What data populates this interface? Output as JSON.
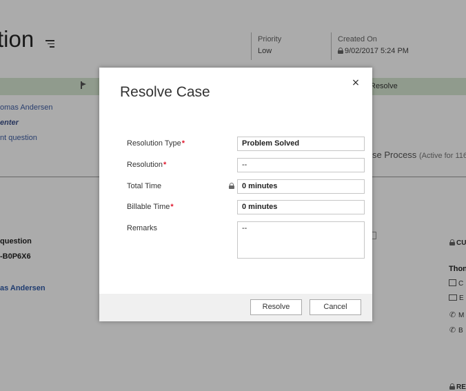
{
  "page": {
    "title_fragment": "tion",
    "header": {
      "priority_label": "Priority",
      "priority_value": "Low",
      "created_on_label": "Created On",
      "created_on_value": "9/02/2017  5:24 PM"
    },
    "process_bar": {
      "resolve_stage_label": "Resolve"
    },
    "stage_fields": {
      "owner": "omas Andersen",
      "origin": "enter",
      "subject": "nt question"
    },
    "process_label": "se Process",
    "process_sub": "(Active for 116",
    "summary": {
      "title": "question",
      "case_number": "-B0P6X6",
      "customer": "as Andersen"
    },
    "customer_panel": {
      "section": "CU",
      "name": "Thon",
      "rows": [
        "C",
        "E",
        "M",
        "B"
      ],
      "section2": "RE"
    }
  },
  "dialog": {
    "title": "Resolve Case",
    "close_glyph": "×",
    "fields": [
      {
        "label": "Resolution Type",
        "required": "*",
        "value": "Problem Solved"
      },
      {
        "label": "Resolution",
        "required": "*",
        "value": "--"
      },
      {
        "label": "Total Time",
        "required": "",
        "value": "0 minutes"
      },
      {
        "label": "Billable Time",
        "required": "*",
        "value": "0 minutes"
      },
      {
        "label": "Remarks",
        "required": "",
        "value": "--"
      }
    ],
    "buttons": {
      "resolve": "Resolve",
      "cancel": "Cancel"
    }
  },
  "colors": {
    "process_bar": "#d7e8d2",
    "required": "#e0172d",
    "link": "#2f5aa8"
  }
}
